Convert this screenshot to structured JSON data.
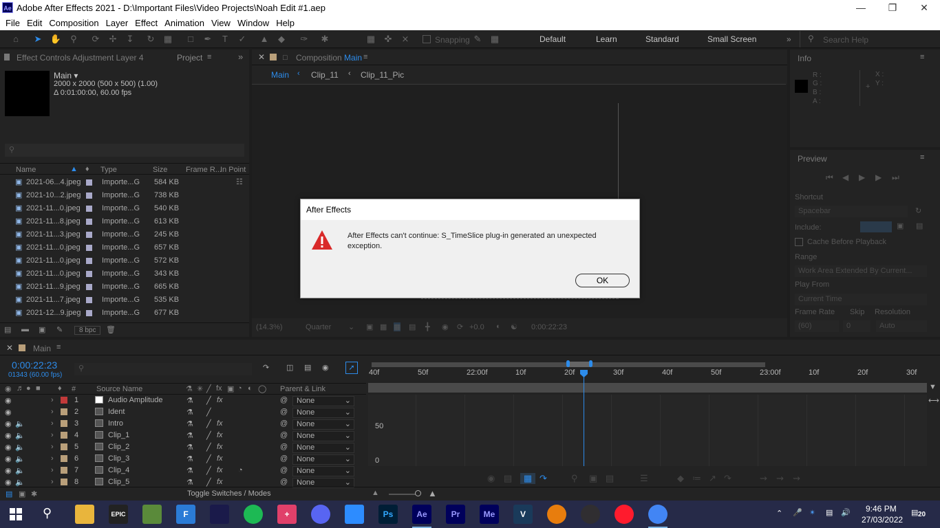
{
  "window": {
    "title": "Adobe After Effects 2021 - D:\\Important Files\\Video Projects\\Noah Edit #1.aep",
    "logo": "Ae",
    "controls": [
      "minimize-icon",
      "restore-icon",
      "close-icon"
    ]
  },
  "menu": [
    "File",
    "Edit",
    "Composition",
    "Layer",
    "Effect",
    "Animation",
    "View",
    "Window",
    "Help"
  ],
  "toolbar": {
    "snapping_label": "Snapping",
    "workspaces": [
      "Default",
      "Learn",
      "Standard",
      "Small Screen"
    ],
    "search_placeholder": "Search Help"
  },
  "left_panel": {
    "tab_effect_controls": "Effect Controls Adjustment Layer 4",
    "tab_project": "Project",
    "comp_name": "Main",
    "comp_dims": "2000 x 2000  (500 x 500) (1.00)",
    "comp_duration": "Δ 0:01:00:00, 60.00 fps",
    "columns": [
      "Name",
      "Type",
      "Size",
      "Frame R...",
      "In Point"
    ],
    "files": [
      {
        "name": "2021-06...4.jpeg",
        "type": "Importe...G",
        "size": "584 KB"
      },
      {
        "name": "2021-10...2.jpeg",
        "type": "Importe...G",
        "size": "738 KB"
      },
      {
        "name": "2021-11...0.jpeg",
        "type": "Importe...G",
        "size": "540 KB"
      },
      {
        "name": "2021-11...8.jpeg",
        "type": "Importe...G",
        "size": "613 KB"
      },
      {
        "name": "2021-11...3.jpeg",
        "type": "Importe...G",
        "size": "245 KB"
      },
      {
        "name": "2021-11...0.jpeg",
        "type": "Importe...G",
        "size": "657 KB"
      },
      {
        "name": "2021-11...0.jpeg",
        "type": "Importe...G",
        "size": "572 KB"
      },
      {
        "name": "2021-11...0.jpeg",
        "type": "Importe...G",
        "size": "343 KB"
      },
      {
        "name": "2021-11...9.jpeg",
        "type": "Importe...G",
        "size": "665 KB"
      },
      {
        "name": "2021-11...7.jpeg",
        "type": "Importe...G",
        "size": "535 KB"
      },
      {
        "name": "2021-12...9.jpeg",
        "type": "Importe...G",
        "size": "677 KB"
      }
    ],
    "bpc": "8 bpc"
  },
  "comp_panel": {
    "tab_label": "Composition",
    "tab_name": "Main",
    "breadcrumbs": [
      "Main",
      "Clip_11",
      "Clip_11_Pic"
    ],
    "zoom": "(14.3%)",
    "resolution": "Quarter",
    "exposure": "+0.0",
    "timecode": "0:00:22:23"
  },
  "info_panel": {
    "title": "Info",
    "channels": [
      "R :",
      "G :",
      "B :",
      "A :"
    ],
    "coords": [
      "X :",
      "Y :"
    ]
  },
  "preview_panel": {
    "title": "Preview",
    "shortcut_label": "Shortcut",
    "shortcut_value": "Spacebar",
    "include_label": "Include:",
    "cache_label": "Cache Before Playback",
    "range_label": "Range",
    "range_value": "Work Area Extended By Current...",
    "play_from_label": "Play From",
    "play_from_value": "Current Time",
    "frame_rate_label": "Frame Rate",
    "skip_label": "Skip",
    "resolution_label": "Resolution",
    "frame_rate_value": "(60)",
    "skip_value": "0",
    "resolution_value": "Auto"
  },
  "timeline": {
    "tab_name": "Main",
    "timecode": "0:00:22:23",
    "frame_info": "01343 (60.00 fps)",
    "col_source_name": "Source Name",
    "col_parent": "Parent & Link",
    "ruler": [
      "40f",
      "50f",
      "22:00f",
      "10f",
      "20f",
      "30f",
      "40f",
      "50f",
      "23:00f",
      "10f",
      "20f",
      "30f"
    ],
    "graph_labels": [
      "50",
      "0"
    ],
    "toggle_label": "Toggle Switches / Modes",
    "layers": [
      {
        "num": "1",
        "name": "Audio Amplitude",
        "parent": "None",
        "color": "#c23a3a"
      },
      {
        "num": "2",
        "name": "Ident",
        "parent": "None",
        "color": "#b99f7a"
      },
      {
        "num": "3",
        "name": "Intro",
        "parent": "None",
        "color": "#b99f7a"
      },
      {
        "num": "4",
        "name": "Clip_1",
        "parent": "None",
        "color": "#b99f7a"
      },
      {
        "num": "5",
        "name": "Clip_2",
        "parent": "None",
        "color": "#b99f7a"
      },
      {
        "num": "6",
        "name": "Clip_3",
        "parent": "None",
        "color": "#b99f7a"
      },
      {
        "num": "7",
        "name": "Clip_4",
        "parent": "None",
        "color": "#b99f7a"
      },
      {
        "num": "8",
        "name": "Clip_5",
        "parent": "None",
        "color": "#b99f7a"
      }
    ]
  },
  "dialog": {
    "title": "After Effects",
    "message": "After Effects can't continue: S_TimeSlice plug-in generated an unexpected exception.",
    "ok_label": "OK"
  },
  "taskbar": {
    "apps": [
      "start-icon",
      "search-icon",
      "file-explorer-icon",
      "epic-games-icon",
      "minecraft-icon",
      "fusion-icon",
      "game-icon",
      "spotify-icon",
      "app-icon",
      "discord-icon",
      "zoom-icon",
      "photoshop-icon",
      "after-effects-icon",
      "premiere-icon",
      "media-encoder-icon",
      "vegas-icon",
      "blender-icon",
      "obs-icon",
      "opera-icon",
      "chrome-icon"
    ],
    "app_labels": {
      "epic": "EPIC",
      "ps": "Ps",
      "ae": "Ae",
      "pr": "Pr",
      "me": "Me",
      "v": "V"
    },
    "time": "9:46 PM",
    "date": "27/03/2022",
    "notifications": "20"
  },
  "colors": {
    "accent_blue": "#2d8ceb",
    "panel_bg": "#232323",
    "taskbar_bg": "#262a48",
    "warning_red": "#d92a2a"
  }
}
